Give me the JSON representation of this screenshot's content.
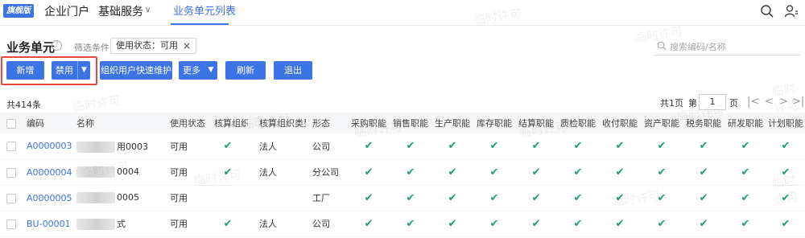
{
  "nav": {
    "badge": "旗舰版",
    "portal": "企业门户",
    "basic_services": "基础服务",
    "active_tab": "业务单元列表"
  },
  "page": {
    "title": "业务单元",
    "filter_label": "筛选条件",
    "filter_chip": "使用状态：可用",
    "search_placeholder": "搜索编码/名称"
  },
  "toolbar": {
    "new": "新增",
    "disable": "禁用",
    "quick_maintain": "组织用户快速维护",
    "more": "更多",
    "refresh": "刷新",
    "exit": "退出"
  },
  "pagination": {
    "total": "共414条",
    "pages": "共1页",
    "goto_prefix": "第",
    "current_page": "1",
    "goto_suffix": "页"
  },
  "watermark": "临时许可",
  "table": {
    "columns": [
      "编码",
      "名称",
      "使用状态",
      "核算组织",
      "核算组织类型",
      "形态",
      "采购职能",
      "销售职能",
      "生产职能",
      "库存职能",
      "结算职能",
      "质检职能",
      "收付职能",
      "资产职能",
      "税务职能",
      "研发职能",
      "计划职能"
    ],
    "rows": [
      {
        "code": "A0000003",
        "name_suffix": "用0003",
        "status": "可用",
        "acct_org": true,
        "acct_type": "法人",
        "form": "公司",
        "funcs": [
          true,
          true,
          true,
          true,
          true,
          true,
          true,
          true,
          true,
          true,
          true
        ]
      },
      {
        "code": "A0000004",
        "name_suffix": "0004",
        "status": "可用",
        "acct_org": true,
        "acct_type": "法人",
        "form": "分公司",
        "funcs": [
          true,
          true,
          true,
          true,
          true,
          true,
          true,
          true,
          true,
          true,
          true
        ]
      },
      {
        "code": "A0000005",
        "name_suffix": "0005",
        "status": "可用",
        "acct_org": false,
        "acct_type": "",
        "form": "工厂",
        "funcs": [
          true,
          true,
          true,
          true,
          true,
          true,
          true,
          true,
          true,
          true,
          true
        ]
      },
      {
        "code": "BU-00001",
        "name_suffix": "式",
        "status": "可用",
        "acct_org": true,
        "acct_type": "法人",
        "form": "公司",
        "funcs": [
          true,
          true,
          true,
          true,
          true,
          true,
          true,
          true,
          true,
          true,
          true
        ]
      }
    ]
  }
}
